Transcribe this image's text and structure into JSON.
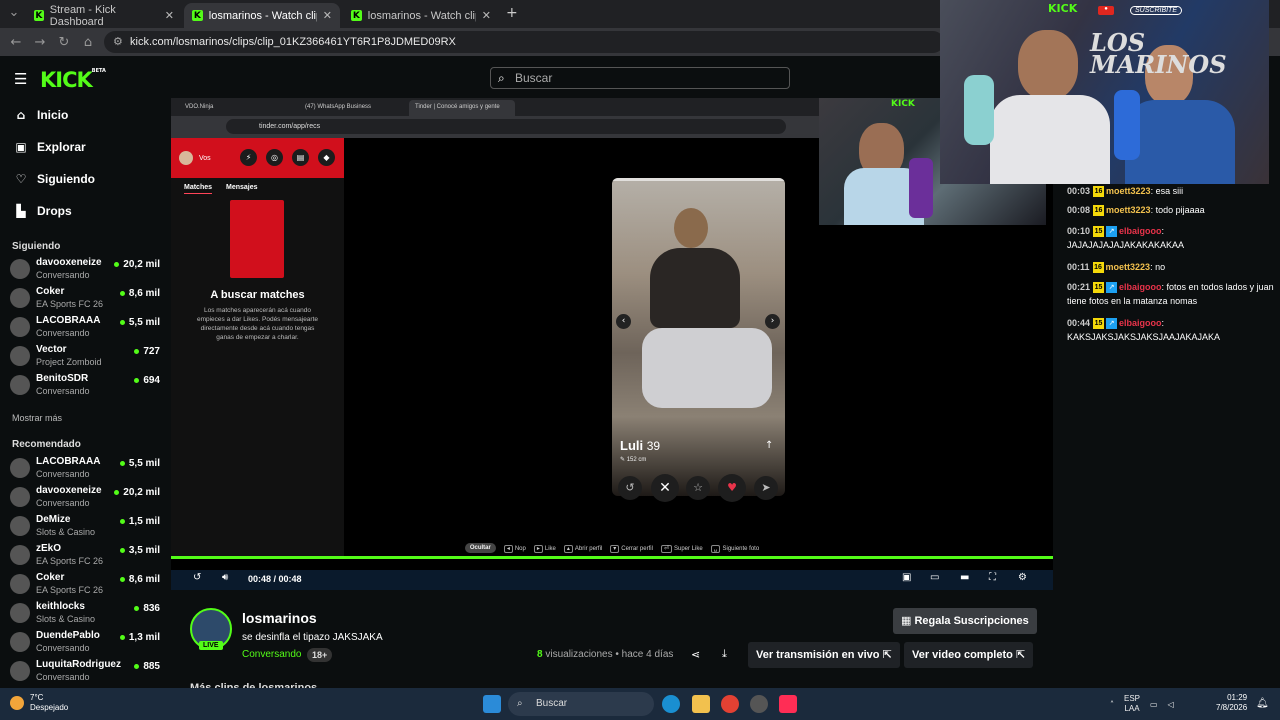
{
  "browser": {
    "tabs": [
      {
        "title": "Stream - Kick Dashboard",
        "active": false
      },
      {
        "title": "losmarinos - Watch clips on Kick",
        "active": true
      },
      {
        "title": "losmarinos - Watch clips on Kick",
        "active": false
      }
    ],
    "url": "kick.com/losmarinos/clips/clip_01KZ366461YT6R1P8JDMED09RX"
  },
  "header": {
    "logo": "KICK",
    "logo_tag": "BETA",
    "search_placeholder": "Buscar"
  },
  "sidebar": {
    "nav": [
      {
        "label": "Inicio",
        "icon": "home-icon"
      },
      {
        "label": "Explorar",
        "icon": "compass-icon"
      },
      {
        "label": "Siguiendo",
        "icon": "heart-icon"
      },
      {
        "label": "Drops",
        "icon": "drops-icon"
      }
    ],
    "following_title": "Siguiendo",
    "following": [
      {
        "name": "davooxeneize",
        "game": "Conversando",
        "viewers": "20,2 mil"
      },
      {
        "name": "Coker",
        "game": "EA Sports FC 26",
        "viewers": "8,6 mil"
      },
      {
        "name": "LACOBRAAA",
        "game": "Conversando",
        "viewers": "5,5 mil"
      },
      {
        "name": "Vector",
        "game": "Project Zomboid",
        "viewers": "727"
      },
      {
        "name": "BenitoSDR",
        "game": "Conversando",
        "viewers": "694"
      }
    ],
    "show_more": "Mostrar más",
    "recommended_title": "Recomendado",
    "recommended": [
      {
        "name": "LACOBRAAA",
        "game": "Conversando",
        "viewers": "5,5 mil"
      },
      {
        "name": "davooxeneize",
        "game": "Conversando",
        "viewers": "20,2 mil"
      },
      {
        "name": "DeMize",
        "game": "Slots & Casino",
        "viewers": "1,5 mil"
      },
      {
        "name": "zEkO",
        "game": "EA Sports FC 26",
        "viewers": "3,5 mil"
      },
      {
        "name": "Coker",
        "game": "EA Sports FC 26",
        "viewers": "8,6 mil"
      },
      {
        "name": "keithlocks",
        "game": "Slots & Casino",
        "viewers": "836"
      },
      {
        "name": "DuendePablo",
        "game": "Conversando",
        "viewers": "1,3 mil"
      },
      {
        "name": "LuquitaRodriguez",
        "game": "Conversando",
        "viewers": "885"
      }
    ]
  },
  "video": {
    "inner_tabs": [
      "VDO.Ninja",
      "(47) WhatsApp Business",
      "Tinder | Conocé amigos y gente"
    ],
    "inner_url": "tinder.com/app/recs",
    "tinder": {
      "user": "Vos",
      "tabs": [
        "Matches",
        "Mensajes"
      ],
      "empty_title": "A buscar matches",
      "empty_text": "Los matches aparecerán acá cuando empieces a dar Likes. Podés mensajearte directamente desde acá cuando tengas ganas de empezar a charlar.",
      "profile_name": "Luli",
      "profile_age": "39",
      "profile_height": "152 cm",
      "hints": [
        {
          "key": "Ocultar",
          "label": ""
        },
        {
          "key": "◂",
          "label": "Nop"
        },
        {
          "key": "▸",
          "label": "Like"
        },
        {
          "key": "▴",
          "label": "Abrir perfil"
        },
        {
          "key": "▾",
          "label": "Cerrar perfil"
        },
        {
          "key": "⏎",
          "label": "Super Like"
        },
        {
          "key": "␣",
          "label": "Siguiente foto"
        }
      ]
    },
    "time": "00:48 / 00:48",
    "progress": 1.0,
    "cam_text_1": "KICK",
    "cam_text_2": "LOS MARINOS",
    "cam_sub": "SUSCRIBITE"
  },
  "chat": [
    {
      "time": "00:03",
      "badge": "16",
      "user": "moett3223",
      "text": "esa siii",
      "style": "u1"
    },
    {
      "time": "00:08",
      "badge": "16",
      "user": "moett3223",
      "text": "todo pijaaaa",
      "style": "u1"
    },
    {
      "time": "00:10",
      "badge": "15",
      "user": "elbaigooo",
      "text": "JAJAJAJAJAJAKAKAKAKAA",
      "style": "u2"
    },
    {
      "time": "00:11",
      "badge": "16",
      "user": "moett3223",
      "text": "no",
      "style": "u1"
    },
    {
      "time": "00:21",
      "badge": "15",
      "user": "elbaigooo",
      "text": "fotos en todos lados y juan tiene fotos en la matanza nomas",
      "style": "u2"
    },
    {
      "time": "00:44",
      "badge": "15",
      "user": "elbaigooo",
      "text": "KAKSJAKSJAKSJAKSJAAJAKAJAKA",
      "style": "u2"
    }
  ],
  "clip_info": {
    "channel": "losmarinos",
    "title": "se desinfla el tipazo JAKSJAKA",
    "category": "Conversando",
    "age_rating": "18+",
    "live_badge": "LIVE",
    "views_count": "8",
    "views_label": "visualizaciones",
    "posted": "• hace 4 días",
    "subs_button": "Regala Suscripciones",
    "live_button": "Ver transmisión en vivo",
    "full_button": "Ver video completo",
    "more_clips": "Más clips de losmarinos"
  },
  "taskbar": {
    "temp": "7°C",
    "weather": "Despejado",
    "search": "Buscar",
    "lang": "ESP",
    "lang2": "LAA",
    "time": "01:29",
    "date": "7/8/2026"
  }
}
